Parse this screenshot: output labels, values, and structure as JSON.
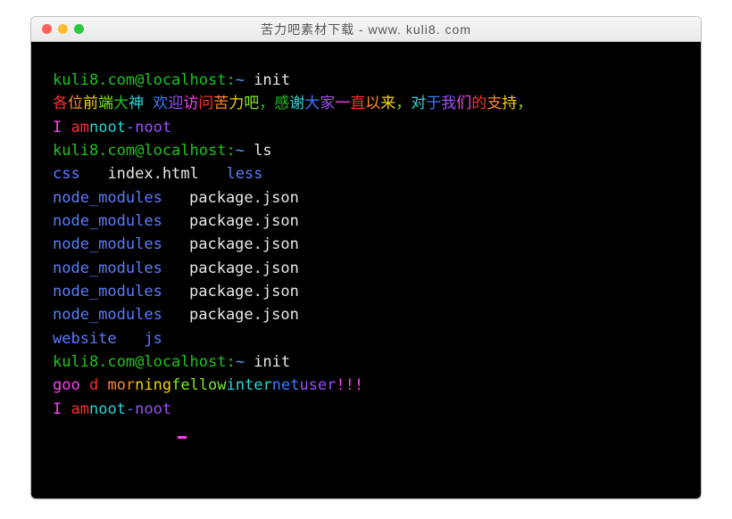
{
  "window": {
    "title": "苦力吧素材下载 - www. kuli8. com"
  },
  "prompt": {
    "user_host": "kuli8.com@localhost:",
    "path": "~"
  },
  "blocks": [
    {
      "command": "init",
      "lines": [
        {
          "type": "rainbow",
          "segments": [
            {
              "t": "各",
              "c": "red"
            },
            {
              "t": "位",
              "c": "orange"
            },
            {
              "t": "前",
              "c": "yellow"
            },
            {
              "t": "端",
              "c": "lime"
            },
            {
              "t": "大",
              "c": "green"
            },
            {
              "t": "神 ",
              "c": "cyan"
            },
            {
              "t": "欢",
              "c": "blue"
            },
            {
              "t": "迎",
              "c": "purple"
            },
            {
              "t": "访",
              "c": "magenta"
            },
            {
              "t": "问",
              "c": "red"
            },
            {
              "t": "苦",
              "c": "orange"
            },
            {
              "t": "力",
              "c": "yellow"
            },
            {
              "t": "吧",
              "c": "lime"
            },
            {
              "t": "，",
              "c": "green"
            },
            {
              "t": "感",
              "c": "green"
            },
            {
              "t": "谢",
              "c": "cyan"
            },
            {
              "t": "大",
              "c": "blue"
            },
            {
              "t": "家",
              "c": "purple"
            },
            {
              "t": "一",
              "c": "magenta"
            },
            {
              "t": "直",
              "c": "red"
            },
            {
              "t": "以",
              "c": "orange"
            },
            {
              "t": "来",
              "c": "yellow"
            },
            {
              "t": "，",
              "c": "lime"
            },
            {
              "t": "对",
              "c": "cyan"
            },
            {
              "t": "于",
              "c": "blue"
            },
            {
              "t": "我",
              "c": "purple"
            },
            {
              "t": "们",
              "c": "magenta"
            },
            {
              "t": "的",
              "c": "red"
            },
            {
              "t": "支",
              "c": "orange"
            },
            {
              "t": "持",
              "c": "yellow"
            },
            {
              "t": "，",
              "c": "lime"
            }
          ]
        },
        {
          "type": "rainbow",
          "segments": [
            {
              "t": "I ",
              "c": "magenta"
            },
            {
              "t": "am",
              "c": "red"
            },
            {
              "t": "noot",
              "c": "cyan"
            },
            {
              "t": "-",
              "c": "blue"
            },
            {
              "t": "noot",
              "c": "purple"
            }
          ]
        }
      ]
    },
    {
      "command": "ls",
      "ls_first": [
        {
          "t": "css",
          "c": "ls-blue"
        },
        {
          "t": "index.html",
          "c": "ls-white"
        },
        {
          "t": "less",
          "c": "ls-blue"
        }
      ],
      "ls_rows": [
        [
          "node_modules",
          "package.json"
        ],
        [
          "node_modules",
          "package.json"
        ],
        [
          "node_modules",
          "package.json"
        ],
        [
          "node_modules",
          "package.json"
        ],
        [
          "node_modules",
          "package.json"
        ],
        [
          "node_modules",
          "package.json"
        ]
      ],
      "ls_last": [
        {
          "t": "website",
          "c": "ls-blue"
        },
        {
          "t": "js",
          "c": "ls-blue"
        }
      ]
    },
    {
      "command": "init",
      "lines": [
        {
          "type": "rainbow",
          "segments": [
            {
              "t": "goo ",
              "c": "magenta"
            },
            {
              "t": "d ",
              "c": "red"
            },
            {
              "t": "mor",
              "c": "orange"
            },
            {
              "t": "ning",
              "c": "yellow"
            },
            {
              "t": "fellow",
              "c": "lime"
            },
            {
              "t": "inter",
              "c": "cyan"
            },
            {
              "t": "net",
              "c": "blue"
            },
            {
              "t": "user",
              "c": "purple"
            },
            {
              "t": "!!!",
              "c": "magenta"
            }
          ]
        },
        {
          "type": "rainbow",
          "segments": [
            {
              "t": "I ",
              "c": "magenta"
            },
            {
              "t": "am",
              "c": "red"
            },
            {
              "t": "noot",
              "c": "cyan"
            },
            {
              "t": "-",
              "c": "blue"
            },
            {
              "t": "noot",
              "c": "purple"
            }
          ]
        }
      ]
    }
  ]
}
